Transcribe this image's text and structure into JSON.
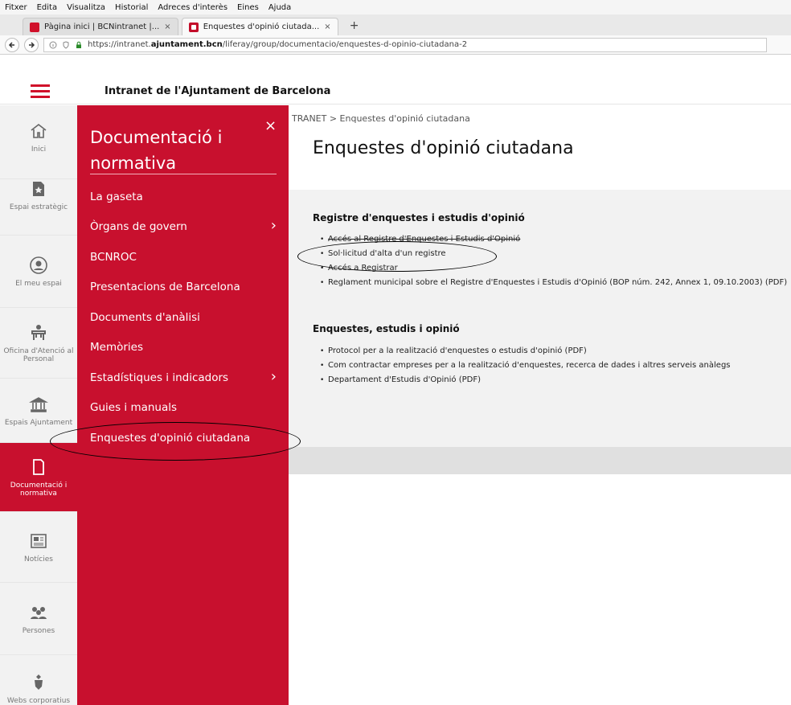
{
  "browser": {
    "menu": [
      "Fitxer",
      "Edita",
      "Visualitza",
      "Historial",
      "Adreces d'interès",
      "Eines",
      "Ajuda"
    ],
    "tabs": [
      {
        "title": "Pàgina inici | BCNintranet |...",
        "close": "×"
      },
      {
        "title": "Enquestes d'opinió ciutada...",
        "close": "×"
      }
    ],
    "new_tab": "+",
    "url_prefix": "https://intranet.",
    "url_host": "ajuntament.bcn",
    "url_path": "/liferay/group/documentacio/enquestes-d-opinio-ciutadana-2"
  },
  "header": {
    "site_title": "Intranet de l'Ajuntament de Barcelona"
  },
  "rail": {
    "items": [
      {
        "label": "Inici",
        "icon": "home-icon"
      },
      {
        "label": "Espai estratègic",
        "icon": "star-doc-icon"
      },
      {
        "label": "El meu espai",
        "icon": "user-icon"
      },
      {
        "label": "Oficina d'Atenció al Personal",
        "icon": "service-desk-icon"
      },
      {
        "label": "Espais Ajuntament",
        "icon": "building-icon"
      },
      {
        "label": "Documentació i normativa",
        "icon": "document-icon"
      },
      {
        "label": "Notícies",
        "icon": "news-icon"
      },
      {
        "label": "Persones",
        "icon": "people-icon"
      },
      {
        "label": "Webs corporatius",
        "icon": "shield-icon"
      }
    ]
  },
  "flyout": {
    "title": "Documentació i normativa",
    "close": "×",
    "items": [
      {
        "label": "La gaseta"
      },
      {
        "label": "Òrgans de govern",
        "chevron": "›"
      },
      {
        "label": "BCNROC"
      },
      {
        "label": "Presentacions de Barcelona"
      },
      {
        "label": "Documents d'anàlisi"
      },
      {
        "label": "Memòries"
      },
      {
        "label": "Estadístiques i indicadors",
        "chevron": "›"
      },
      {
        "label": "Guies i manuals"
      },
      {
        "label": "Enquestes d'opinió ciutadana"
      }
    ]
  },
  "main": {
    "breadcrumb": "TRANET > Enquestes d'opinió ciutadana",
    "title": "Enquestes d'opinió ciutadana",
    "sections": [
      {
        "title": "Registre d'enquestes i estudis d'opinió",
        "items": [
          "Accés al Registre d'Enquestes i Estudis d'Opinió",
          "Sol·licitud d'alta d'un registre",
          "Accés a Registrar",
          "Reglament municipal sobre el Registre d'Enquestes i Estudis d'Opinió (BOP núm. 242, Annex 1, 09.10.2003) (PDF)"
        ]
      },
      {
        "title": "Enquestes, estudis i opinió",
        "items": [
          "Protocol per a la realització d'enquestes o estudis d'opinió (PDF)",
          "Com contractar empreses per a la realització d'enquestes, recerca de dades i altres serveis anàlegs",
          "Departament d'Estudis d'Opinió (PDF)"
        ]
      }
    ]
  },
  "colors": {
    "brand_red": "#c8102e",
    "rail_bg": "#f2f2f2",
    "panel_bg": "#f2f2f2"
  }
}
